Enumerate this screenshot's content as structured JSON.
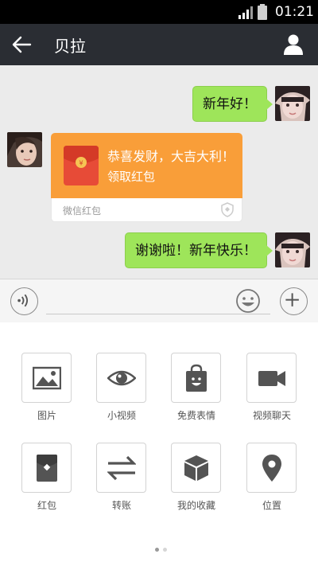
{
  "status_bar": {
    "time": "01:21",
    "signal_icon": "signal-icon",
    "battery_icon": "battery-icon"
  },
  "header": {
    "title": "贝拉",
    "back_icon": "back-arrow-icon",
    "profile_icon": "person-icon"
  },
  "messages": [
    {
      "side": "right",
      "type": "text",
      "text": "新年好！"
    },
    {
      "side": "left",
      "type": "red_packet",
      "wish": "恭喜发财，大吉大利！",
      "action": "领取红包",
      "source": "微信红包"
    },
    {
      "side": "right",
      "type": "text",
      "text": "谢谢啦！新年快乐！"
    }
  ],
  "input_bar": {
    "placeholder": "",
    "voice_icon": "voice-icon",
    "emoji_icon": "emoji-icon",
    "plus_icon": "plus-icon"
  },
  "tools": [
    {
      "label": "图片",
      "icon": "image-icon"
    },
    {
      "label": "小视频",
      "icon": "eye-icon"
    },
    {
      "label": "免费表情",
      "icon": "sticker-bag-icon"
    },
    {
      "label": "视频聊天",
      "icon": "video-camera-icon"
    },
    {
      "label": "红包",
      "icon": "red-packet-icon"
    },
    {
      "label": "转账",
      "icon": "transfer-arrows-icon"
    },
    {
      "label": "我的收藏",
      "icon": "box-icon"
    },
    {
      "label": "位置",
      "icon": "location-pin-icon"
    }
  ],
  "pager": {
    "pages": 2,
    "current": 1
  },
  "colors": {
    "header_bg": "#2a2d33",
    "chat_bg": "#ebebeb",
    "bubble_green": "#9ee55a",
    "red_packet_orange": "#f99e39",
    "tool_icon": "#545454"
  }
}
